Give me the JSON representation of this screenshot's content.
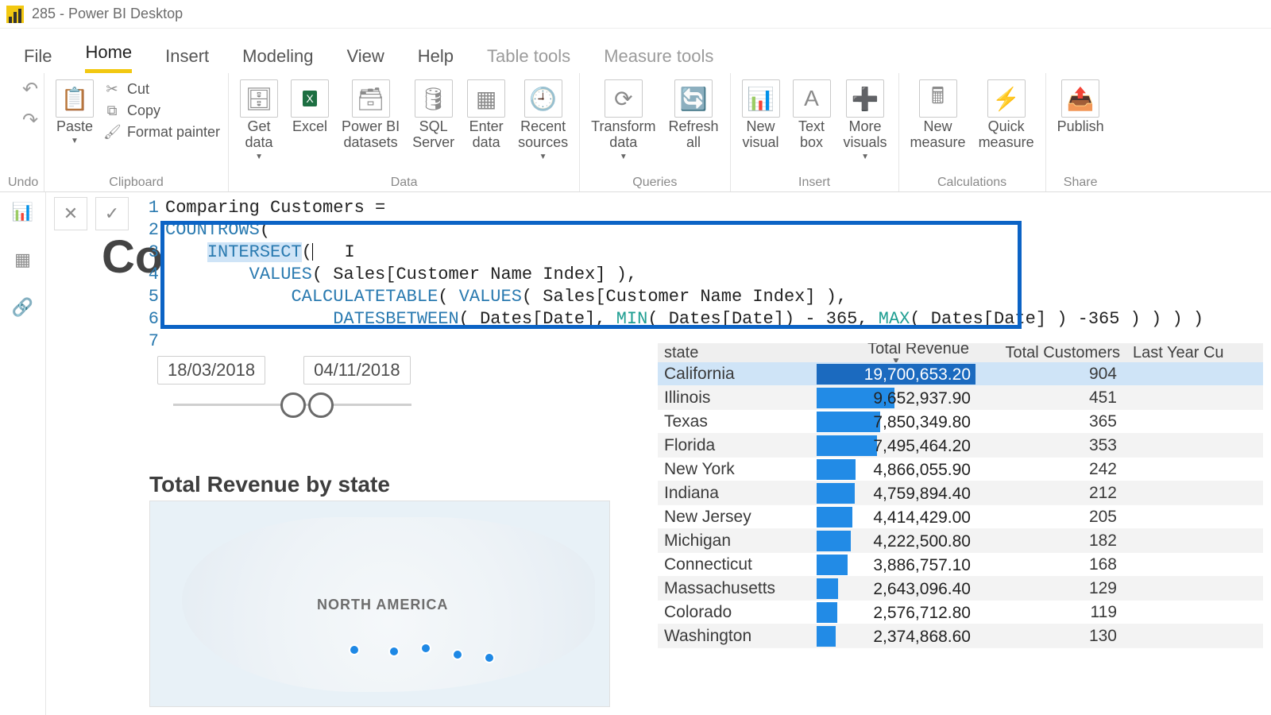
{
  "title": "285 - Power BI Desktop",
  "tabs": [
    "File",
    "Home",
    "Insert",
    "Modeling",
    "View",
    "Help",
    "Table tools",
    "Measure tools"
  ],
  "active_tab": 1,
  "ribbon": {
    "undo": {
      "undo": "↶",
      "redo": "↷",
      "label": "Undo"
    },
    "clipboard": {
      "paste": "Paste",
      "cut": "Cut",
      "copy": "Copy",
      "format_painter": "Format painter",
      "label": "Clipboard"
    },
    "data": {
      "get_data": "Get\ndata",
      "excel": "Excel",
      "pbi_ds": "Power BI\ndatasets",
      "sql": "SQL\nServer",
      "enter": "Enter\ndata",
      "recent": "Recent\nsources",
      "label": "Data"
    },
    "queries": {
      "transform": "Transform\ndata",
      "refresh": "Refresh\nall",
      "label": "Queries"
    },
    "insert": {
      "new_visual": "New\nvisual",
      "text_box": "Text\nbox",
      "more": "More\nvisuals",
      "label": "Insert"
    },
    "calc": {
      "new_measure": "New\nmeasure",
      "quick": "Quick\nmeasure",
      "label": "Calculations"
    },
    "share": {
      "publish": "Publish",
      "label": "Share"
    }
  },
  "formula": {
    "lines": [
      "1",
      "2",
      "3",
      "4",
      "5",
      "6",
      "7"
    ],
    "l1": "Comparing Customers =",
    "l2a": "COUNTROWS",
    "l2b": "(",
    "l3a": "INTERSECT",
    "l3b": "(",
    "l4a": "VALUES",
    "l4b": "( Sales[Customer Name Index] ),",
    "l5a": "CALCULATETABLE",
    "l5b": "( ",
    "l5c": "VALUES",
    "l5d": "( Sales[Customer Name Index] ),",
    "l6a": "DATESBETWEEN",
    "l6b": "( Dates[Date], ",
    "l6c": "MIN",
    "l6d": "( Dates[Date]) - 365, ",
    "l6e": "MAX",
    "l6f": "( Dates[Date] ) -365 ) ) ) )"
  },
  "dates": {
    "from": "18/03/2018",
    "to": "04/11/2018"
  },
  "big_title_fragment": "Co",
  "section_title": "Total Revenue by state",
  "map_label": "NORTH AMERICA",
  "table": {
    "headers": {
      "state": "state",
      "rev": "Total Revenue",
      "cust": "Total Customers",
      "last": "Last Year Cu"
    },
    "max_rev": 19700653.2,
    "rows": [
      {
        "state": "California",
        "rev": 19700653.2,
        "rev_fmt": "19,700,653.20",
        "cust": 904,
        "sel": true
      },
      {
        "state": "Illinois",
        "rev": 9652937.9,
        "rev_fmt": "9,652,937.90",
        "cust": 451
      },
      {
        "state": "Texas",
        "rev": 7850349.8,
        "rev_fmt": "7,850,349.80",
        "cust": 365
      },
      {
        "state": "Florida",
        "rev": 7495464.2,
        "rev_fmt": "7,495,464.20",
        "cust": 353
      },
      {
        "state": "New York",
        "rev": 4866055.9,
        "rev_fmt": "4,866,055.90",
        "cust": 242
      },
      {
        "state": "Indiana",
        "rev": 4759894.4,
        "rev_fmt": "4,759,894.40",
        "cust": 212
      },
      {
        "state": "New Jersey",
        "rev": 4414429.0,
        "rev_fmt": "4,414,429.00",
        "cust": 205
      },
      {
        "state": "Michigan",
        "rev": 4222500.8,
        "rev_fmt": "4,222,500.80",
        "cust": 182
      },
      {
        "state": "Connecticut",
        "rev": 3886757.1,
        "rev_fmt": "3,886,757.10",
        "cust": 168
      },
      {
        "state": "Massachusetts",
        "rev": 2643096.4,
        "rev_fmt": "2,643,096.40",
        "cust": 129
      },
      {
        "state": "Colorado",
        "rev": 2576712.8,
        "rev_fmt": "2,576,712.80",
        "cust": 119
      },
      {
        "state": "Washington",
        "rev": 2374868.6,
        "rev_fmt": "2,374,868.60",
        "cust": 130
      }
    ]
  },
  "chart_data": {
    "type": "table",
    "title": "Total Revenue by state",
    "columns": [
      "state",
      "Total Revenue",
      "Total Customers"
    ],
    "rows": [
      [
        "California",
        19700653.2,
        904
      ],
      [
        "Illinois",
        9652937.9,
        451
      ],
      [
        "Texas",
        7850349.8,
        365
      ],
      [
        "Florida",
        7495464.2,
        353
      ],
      [
        "New York",
        4866055.9,
        242
      ],
      [
        "Indiana",
        4759894.4,
        212
      ],
      [
        "New Jersey",
        4414429.0,
        205
      ],
      [
        "Michigan",
        4222500.8,
        182
      ],
      [
        "Connecticut",
        3886757.1,
        168
      ],
      [
        "Massachusetts",
        2643096.4,
        129
      ],
      [
        "Colorado",
        2576712.8,
        119
      ],
      [
        "Washington",
        2374868.6,
        130
      ]
    ]
  }
}
